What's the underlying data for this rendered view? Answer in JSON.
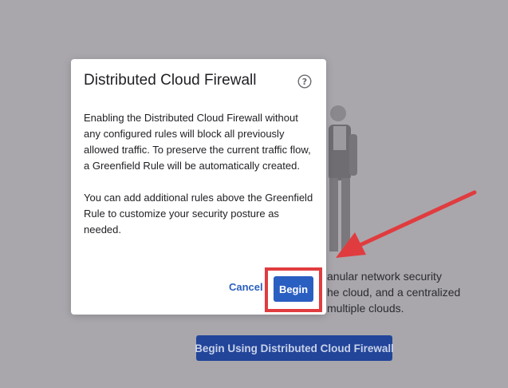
{
  "background": {
    "description_lines": [
      "anular network security",
      "he cloud, and a centralized",
      "multiple clouds."
    ],
    "primary_button_label": "Begin Using Distributed Cloud Firewall"
  },
  "modal": {
    "title": "Distributed Cloud Firewall",
    "help_icon": "question-circle-icon",
    "paragraphs": [
      "Enabling the Distributed Cloud Firewall without any configured rules will block all previously allowed traffic. To preserve the current traffic flow, a Greenfield Rule will be automatically created.",
      "You can add additional rules above the Greenfield Rule to customize your security posture as needed."
    ],
    "cancel_label": "Cancel",
    "begin_label": "Begin"
  },
  "annotation": {
    "highlight_color": "#e03c3f",
    "arrow_color": "#e03c3f"
  },
  "colors": {
    "overlay_background": "#a9a7ac",
    "primary_blue": "#2a5fc2",
    "link_blue": "#2b5fbf"
  }
}
